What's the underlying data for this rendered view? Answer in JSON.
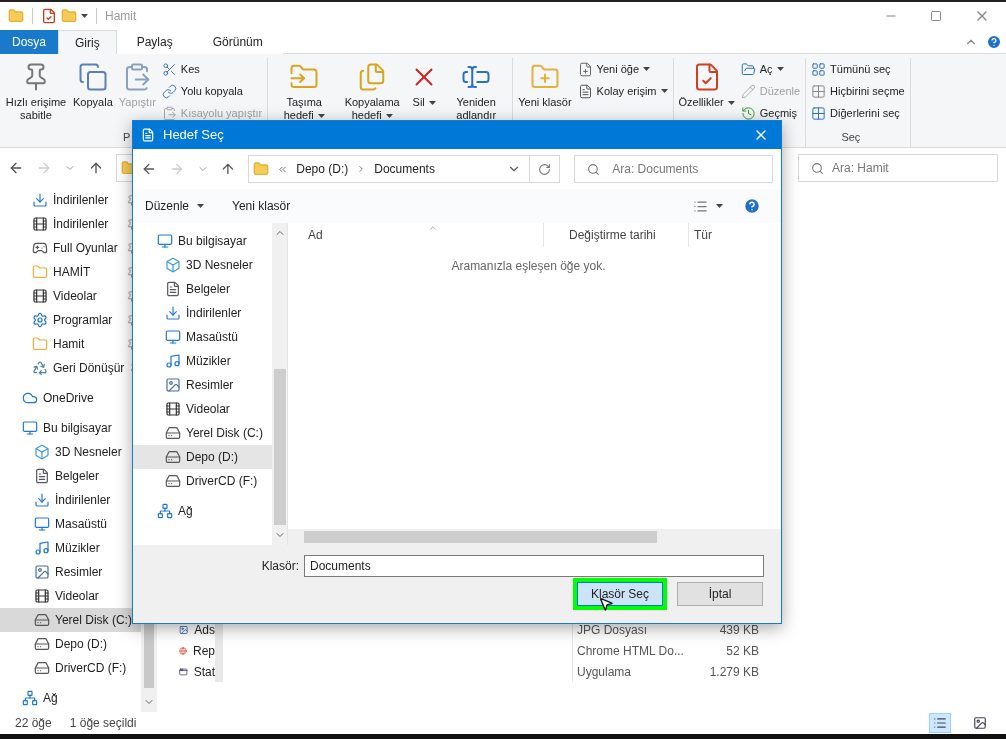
{
  "window": {
    "title": "Hamit"
  },
  "ribbon": {
    "tabs": [
      {
        "label": "Dosya",
        "kind": "file",
        "selected": false
      },
      {
        "label": "Giriş",
        "kind": "tab",
        "selected": true
      },
      {
        "label": "Paylaş",
        "kind": "tab",
        "selected": false
      },
      {
        "label": "Görünüm",
        "kind": "tab",
        "selected": false
      }
    ],
    "groups": [
      {
        "label": "P",
        "commands": [
          {
            "kind": "large",
            "label": "Hızlı erişime sabitle",
            "disabled": false,
            "dropdown": false
          },
          {
            "kind": "large",
            "label": "Kopyala",
            "disabled": false,
            "dropdown": false
          },
          {
            "kind": "large",
            "label": "Yapıştır",
            "disabled": true,
            "dropdown": false
          },
          {
            "kind": "small",
            "label": "Kes",
            "disabled": false,
            "dropdown": false
          },
          {
            "kind": "small",
            "label": "Yolu kopyala",
            "disabled": false,
            "dropdown": false
          },
          {
            "kind": "small",
            "label": "Kısayolu yapıştır",
            "disabled": true,
            "dropdown": false
          }
        ]
      },
      {
        "commands": [
          {
            "kind": "large",
            "label": "Taşıma hedefi",
            "disabled": false,
            "dropdown": true
          },
          {
            "kind": "large",
            "label": "Kopyalama hedefi",
            "disabled": false,
            "dropdown": true
          },
          {
            "kind": "large",
            "label": "Sil",
            "disabled": false,
            "dropdown": true
          },
          {
            "kind": "large",
            "label": "Yeniden adlandır",
            "disabled": false,
            "dropdown": false
          }
        ]
      },
      {
        "commands": [
          {
            "kind": "large",
            "label": "Yeni klasör",
            "disabled": false,
            "dropdown": false
          },
          {
            "kind": "small",
            "label": "Yeni öğe",
            "disabled": false,
            "dropdown": true
          },
          {
            "kind": "small",
            "label": "Kolay erişim",
            "disabled": false,
            "dropdown": true
          }
        ]
      },
      {
        "commands": [
          {
            "kind": "large",
            "label": "Özellikler",
            "disabled": false,
            "dropdown": true
          },
          {
            "kind": "small",
            "label": "Aç",
            "disabled": false,
            "dropdown": true
          },
          {
            "kind": "small",
            "label": "Düzenle",
            "disabled": true,
            "dropdown": false
          },
          {
            "kind": "small",
            "label": "Geçmiş",
            "disabled": false,
            "dropdown": false
          }
        ]
      },
      {
        "label": "Seç",
        "commands": [
          {
            "kind": "small",
            "label": "Tümünü seç",
            "disabled": false,
            "dropdown": false
          },
          {
            "kind": "small",
            "label": "Hiçbirini seçme",
            "disabled": false,
            "dropdown": false
          },
          {
            "kind": "small",
            "label": "Diğerlerini seç",
            "disabled": false,
            "dropdown": false
          }
        ]
      }
    ]
  },
  "search": {
    "placeholder": "Ara: Hamit"
  },
  "nav_pane": {
    "quick_access": [
      {
        "label": "İndirilenler",
        "kind": "downloads",
        "pinned": true,
        "selected": false
      },
      {
        "label": "İndirilenler",
        "kind": "video",
        "pinned": true,
        "selected": false
      },
      {
        "label": "Full Oyunlar",
        "kind": "games",
        "pinned": true,
        "selected": false
      },
      {
        "label": "HAMİT",
        "kind": "folder",
        "pinned": true,
        "selected": false
      },
      {
        "label": "Videolar",
        "kind": "video",
        "pinned": true,
        "selected": false
      },
      {
        "label": "Programlar",
        "kind": "programs",
        "pinned": true,
        "selected": false
      },
      {
        "label": "Hamit",
        "kind": "folder",
        "pinned": true,
        "selected": false
      },
      {
        "label": "Geri Dönüşür",
        "kind": "recycle",
        "pinned": true,
        "selected": false
      }
    ],
    "items": [
      {
        "label": "OneDrive",
        "kind": "cloud",
        "selected": false
      },
      {
        "label": "Bu bilgisayar",
        "kind": "computer",
        "selected": false,
        "children": [
          {
            "label": "3D Nesneler",
            "kind": "objects",
            "selected": false
          },
          {
            "label": "Belgeler",
            "kind": "documents",
            "selected": false
          },
          {
            "label": "İndirilenler",
            "kind": "downloads",
            "selected": false
          },
          {
            "label": "Masaüstü",
            "kind": "desktop",
            "selected": false
          },
          {
            "label": "Müzikler",
            "kind": "music",
            "selected": false
          },
          {
            "label": "Resimler",
            "kind": "pictures",
            "selected": false
          },
          {
            "label": "Videolar",
            "kind": "video",
            "selected": false
          },
          {
            "label": "Yerel Disk (C:)",
            "kind": "systemdrive",
            "selected": true
          },
          {
            "label": "Depo (D:)",
            "kind": "drive",
            "selected": false
          },
          {
            "label": "DriverCD (F:)",
            "kind": "drive",
            "selected": false
          }
        ]
      },
      {
        "label": "Ağ",
        "kind": "network",
        "selected": false
      }
    ]
  },
  "files": [
    {
      "name": "Ads",
      "kind": "image",
      "type": "JPG Dosyası",
      "size": "439 KB"
    },
    {
      "name": "Rep",
      "kind": "html",
      "type": "Chrome HTML Do...",
      "size": "52 KB"
    },
    {
      "name": "Stat",
      "kind": "app",
      "type": "Uygulama",
      "size": "1.279 KB"
    }
  ],
  "status_bar": {
    "count": "22 öğe",
    "selection": "1 öğe seçildi",
    "views": [
      {
        "kind": "details",
        "selected": true
      },
      {
        "kind": "thumbnails",
        "selected": false
      }
    ]
  },
  "dialog": {
    "title": "Hedef Seç",
    "breadcrumb": [
      "Depo (D:)",
      "Documents"
    ],
    "search": {
      "placeholder": "Ara: Documents"
    },
    "commands": [
      {
        "label": "Düzenle",
        "dropdown": true
      },
      {
        "label": "Yeni klasör",
        "dropdown": false
      }
    ],
    "nav": [
      {
        "label": "Bu bilgisayar",
        "kind": "computer",
        "selected": false,
        "children": [
          {
            "label": "3D Nesneler",
            "kind": "objects",
            "selected": false
          },
          {
            "label": "Belgeler",
            "kind": "documents",
            "selected": false
          },
          {
            "label": "İndirilenler",
            "kind": "downloads",
            "selected": false
          },
          {
            "label": "Masaüstü",
            "kind": "desktop",
            "selected": false
          },
          {
            "label": "Müzikler",
            "kind": "music",
            "selected": false
          },
          {
            "label": "Resimler",
            "kind": "pictures",
            "selected": false
          },
          {
            "label": "Videolar",
            "kind": "video",
            "selected": false
          },
          {
            "label": "Yerel Disk (C:)",
            "kind": "systemdrive",
            "selected": false
          },
          {
            "label": "Depo (D:)",
            "kind": "drive",
            "selected": true
          },
          {
            "label": "DriverCD (F:)",
            "kind": "drive",
            "selected": false
          }
        ]
      },
      {
        "label": "Ağ",
        "kind": "network",
        "selected": false
      }
    ],
    "columns": [
      "Ad",
      "Değiştirme tarihi",
      "Tür"
    ],
    "empty_message": "Aramanızla eşleşen öğe yok.",
    "folder_label": "Klasör:",
    "folder_value": "Documents",
    "buttons": [
      {
        "label": "Klasör Seç",
        "highlighted": true
      },
      {
        "label": "İptal",
        "highlighted": false
      }
    ]
  }
}
